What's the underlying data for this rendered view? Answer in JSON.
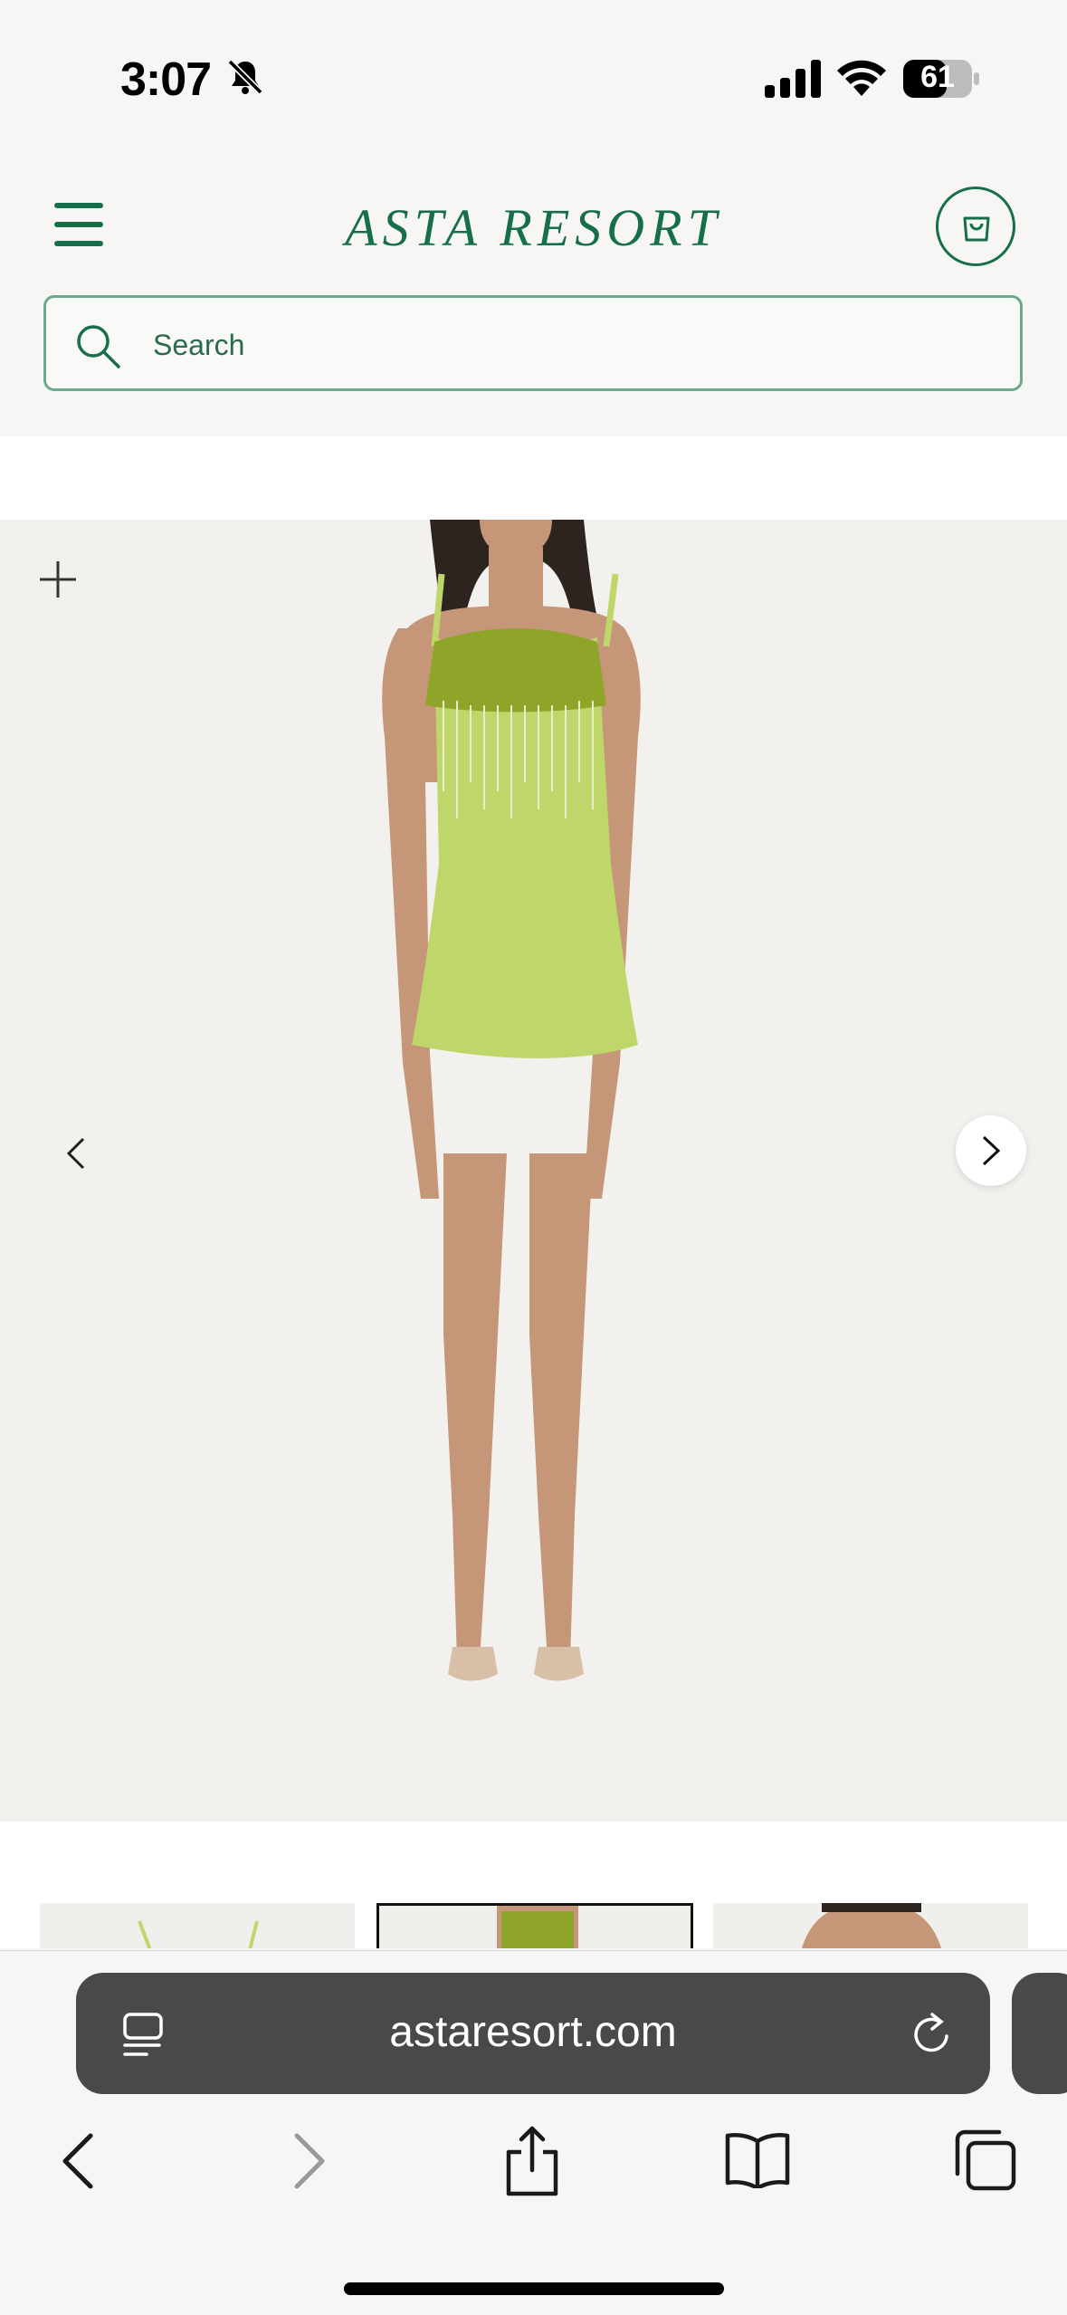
{
  "status_bar": {
    "time": "3:07",
    "battery": "61",
    "icons": [
      "bell-slash-icon",
      "signal-icon",
      "wifi-icon",
      "battery-icon"
    ]
  },
  "header": {
    "brand": "ASTA RESORT",
    "icons": [
      "menu-icon",
      "bag-icon"
    ],
    "search": {
      "placeholder": "Search",
      "value": ""
    }
  },
  "gallery": {
    "icons": [
      "plus-icon",
      "chevron-left-icon",
      "chevron-right-icon"
    ],
    "thumbnail_count": 3
  },
  "browser": {
    "url": "astaresort.com",
    "icons": [
      "page-menu-icon",
      "reload-icon",
      "back-icon",
      "forward-icon",
      "share-icon",
      "bookmarks-icon",
      "tabs-icon"
    ]
  },
  "colors": {
    "brand_green": "#176f4a",
    "dress_green": "#bfd66a",
    "safari_bar": "#494949"
  }
}
